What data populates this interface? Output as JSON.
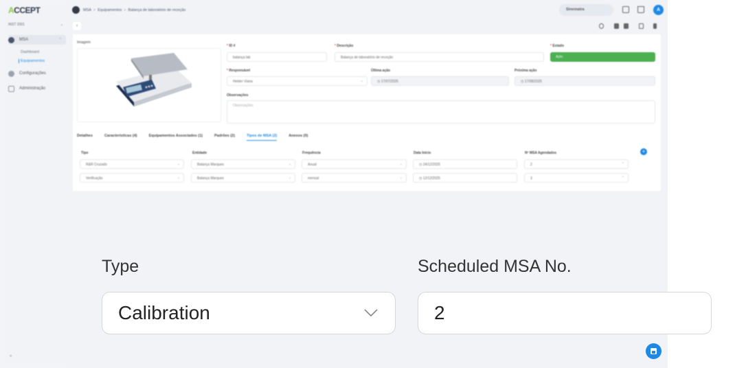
{
  "app": {
    "logo_prefix": "A",
    "logo_rest": "CCEPT"
  },
  "sidebar": {
    "workspace": "INST 2001",
    "items": [
      {
        "label": "MSA",
        "active": true
      },
      {
        "label": "Configurações"
      },
      {
        "label": "Administração"
      }
    ],
    "sub_items": [
      {
        "label": "Dashboard"
      },
      {
        "label": "Equipamentos",
        "active": true
      }
    ],
    "collapse": "«"
  },
  "topbar": {
    "breadcrumb": [
      "MSA",
      "Equipamentos",
      "Balança de laboratório de receção"
    ],
    "search_label": "Sinematra",
    "avatar": "A"
  },
  "form": {
    "image_label": "Imagem",
    "id_label": "ID #",
    "id_value": "balança lab",
    "desc_label": "Descrição",
    "desc_value": "Balança de laboratório de receção",
    "status_label": "Estado",
    "status_value": "Apto",
    "resp_label": "Responsável",
    "resp_value": "Helder Viana",
    "last_label": "Última ação",
    "last_value": "17/07/2025",
    "next_label": "Próxima ação",
    "next_value": "17/08/2025",
    "obs_label": "Observações",
    "obs_placeholder": "Observações"
  },
  "tabs": [
    "Detalhes",
    "Características (4)",
    "Equipamentos Associados (1)",
    "Padrões (2)",
    "Tipos de MSA (2)",
    "Anexos (0)"
  ],
  "msa_table": {
    "headers": [
      "Tipo",
      "Entidade",
      "Frequência",
      "Data Início",
      "Nº MSA Agendados"
    ],
    "rows": [
      [
        "R&R Cruzado",
        "Balança Marques",
        "Anual",
        "24/12/2025",
        "2"
      ],
      [
        "Verificação",
        "Balança Marques",
        "mensal",
        "12/12/2025",
        "3"
      ]
    ]
  },
  "zoom": {
    "type_label": "Type",
    "type_value": "Calibration",
    "scheduled_label": "Scheduled MSA No.",
    "scheduled_value": "2"
  }
}
